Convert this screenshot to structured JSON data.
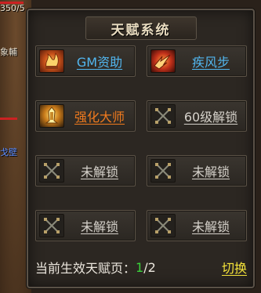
{
  "scene": {
    "fragments": [
      "350/5",
      "象輔",
      "戈壁"
    ]
  },
  "panel": {
    "title": "天赋系统"
  },
  "talent_slots": [
    {
      "label": "GM资助",
      "icon": "gm-flame-icon",
      "color": "#52b7f0"
    },
    {
      "label": "疾风步",
      "icon": "swift-step-icon",
      "color": "#52b7f0"
    },
    {
      "label": "强化大师",
      "icon": "forge-master-icon",
      "color": "#f07a1e"
    },
    {
      "label": "60级解锁",
      "icon": "crossed-swords-lock-icon",
      "color": "#d6d2cb"
    },
    {
      "label": "未解锁",
      "icon": "crossed-swords-lock-icon",
      "color": "#d6d2cb"
    },
    {
      "label": "未解锁",
      "icon": "crossed-swords-lock-icon",
      "color": "#d6d2cb"
    },
    {
      "label": "未解锁",
      "icon": "crossed-swords-lock-icon",
      "color": "#d6d2cb"
    },
    {
      "label": "未解锁",
      "icon": "crossed-swords-lock-icon",
      "color": "#d6d2cb"
    }
  ],
  "status": {
    "label": "当前生效天赋页：",
    "current_page": "1",
    "separator": "/",
    "total_pages": "2",
    "current_color": "#39d33a"
  },
  "switch_button": {
    "label": "切换",
    "color": "#f5e43a"
  }
}
